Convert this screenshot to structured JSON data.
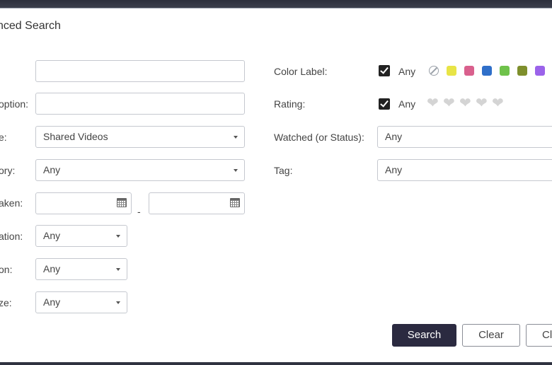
{
  "dialog": {
    "title": "nced Search"
  },
  "left": {
    "labels": [
      "option:",
      "e:",
      "ory:",
      "aken:",
      "ation:",
      "on:",
      "ze:"
    ],
    "file_type_value": "Shared Videos",
    "category_value": "Any",
    "duration_value": "Any",
    "resolution_value": "Any",
    "size_value": "Any",
    "date_separator": "-"
  },
  "right": {
    "color_label": "Color Label:",
    "color_any": "Any",
    "rating_label": "Rating:",
    "rating_any": "Any",
    "watched_label": "Watched (or Status):",
    "watched_value": "Any",
    "tag_label": "Tag:",
    "tag_value": "Any"
  },
  "colors": [
    "#e8e446",
    "#d9608d",
    "#2f6fc9",
    "#6fc24b",
    "#7e8f2c",
    "#9b63ea"
  ],
  "icons": {
    "checkbox": "checkmark-icon",
    "heart": "heart-icon",
    "calendar": "calendar-icon",
    "dropdown": "chevron-down-icon",
    "no_color": "no-color-icon"
  },
  "buttons": {
    "search": "Search",
    "clear": "Clear",
    "close": "Cl"
  }
}
